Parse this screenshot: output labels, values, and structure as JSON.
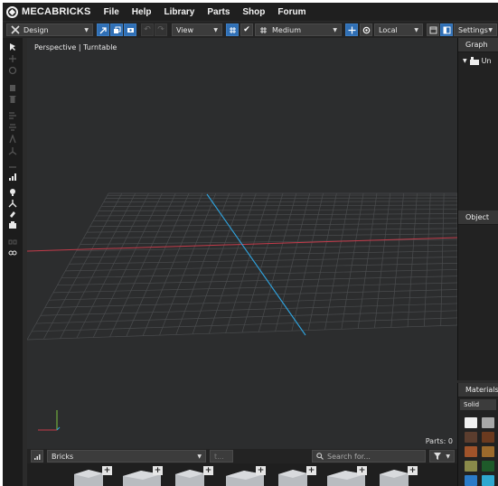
{
  "app": {
    "brand": "MECABRICKS",
    "menu": [
      "File",
      "Help",
      "Library",
      "Parts",
      "Shop",
      "Forum"
    ]
  },
  "toolbar": {
    "mode": "Design",
    "view": "View",
    "quality": "Medium",
    "space": "Local",
    "settings": "Settings"
  },
  "viewport": {
    "label": "Perspective | Turntable",
    "parts_count": "Parts: 0"
  },
  "panels": {
    "graph": {
      "title": "Graph",
      "root_label": "Un"
    },
    "object": {
      "title": "Object"
    },
    "materials": {
      "title": "Materials",
      "mode": "Solid",
      "swatches": [
        "#f0f0f0",
        "#a8a8a8",
        "#5b3d2e",
        "#6b3a1f",
        "#a0532a",
        "#9b6a2c",
        "#8a8a4a",
        "#1e5a2a",
        "#2b7bc8",
        "#2fa8d0"
      ]
    }
  },
  "bottom": {
    "category": "Bricks",
    "subcategory": "t...",
    "search_placeholder": "Search for..."
  },
  "colors": {
    "x_axis": "#c43b4a",
    "z_axis": "#2fa4e0",
    "grid": "#4a4c4e",
    "accent": "#2f6fb5"
  }
}
